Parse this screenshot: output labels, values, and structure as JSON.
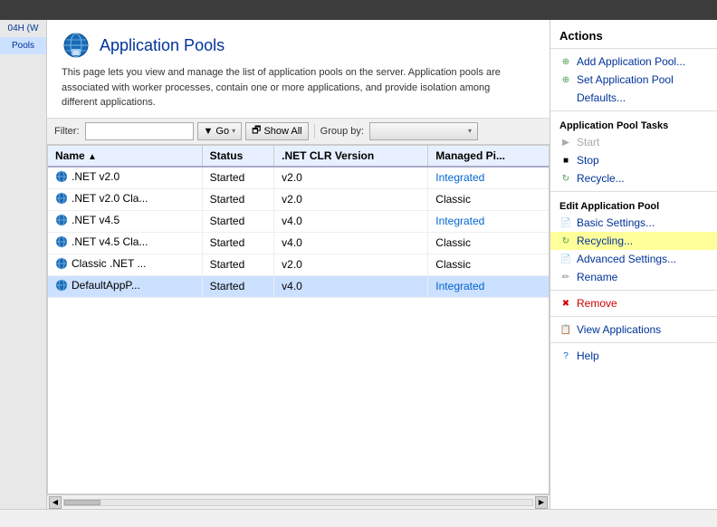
{
  "topBar": {
    "title": ""
  },
  "leftNav": {
    "items": [
      {
        "label": "04H (W",
        "active": false
      },
      {
        "label": "Pools",
        "active": true
      }
    ]
  },
  "pageHeader": {
    "title": "Application Pools",
    "description": "This page lets you view and manage the list of application pools on the server. Application pools are associated with worker processes, contain one or more applications, and provide isolation among different applications."
  },
  "toolbar": {
    "filterLabel": "Filter:",
    "filterValue": "",
    "goLabel": "Go",
    "showAllLabel": "Show All",
    "groupByLabel": "Group by:",
    "groupByValue": ""
  },
  "table": {
    "columns": [
      "Name",
      "Status",
      ".NET CLR Version",
      "Managed Pi..."
    ],
    "rows": [
      {
        "name": ".NET v2.0",
        "status": "Started",
        "clr": "v2.0",
        "managed": "Integrated",
        "selected": false
      },
      {
        "name": ".NET v2.0 Cla...",
        "status": "Started",
        "clr": "v2.0",
        "managed": "Classic",
        "selected": false
      },
      {
        "name": ".NET v4.5",
        "status": "Started",
        "clr": "v4.0",
        "managed": "Integrated",
        "selected": false
      },
      {
        "name": ".NET v4.5 Cla...",
        "status": "Started",
        "clr": "v4.0",
        "managed": "Classic",
        "selected": false
      },
      {
        "name": "Classic .NET ...",
        "status": "Started",
        "clr": "v2.0",
        "managed": "Classic",
        "selected": false
      },
      {
        "name": "DefaultAppP...",
        "status": "Started",
        "clr": "v4.0",
        "managed": "Integrated",
        "selected": true
      }
    ]
  },
  "actions": {
    "title": "Actions",
    "items": [
      {
        "section": null,
        "label": "Add Application Pool...",
        "icon": "add-icon",
        "disabled": false,
        "highlighted": false
      },
      {
        "section": null,
        "label": "Set Application Pool",
        "icon": "set-icon",
        "disabled": false,
        "highlighted": false
      },
      {
        "section": null,
        "label": "Defaults...",
        "icon": null,
        "disabled": false,
        "highlighted": false
      },
      {
        "section": "Application Pool Tasks",
        "label": "",
        "icon": null,
        "disabled": false,
        "highlighted": false
      },
      {
        "section": null,
        "label": "Start",
        "icon": "play-icon",
        "disabled": true,
        "highlighted": false
      },
      {
        "section": null,
        "label": "Stop",
        "icon": "stop-icon",
        "disabled": false,
        "highlighted": false
      },
      {
        "section": null,
        "label": "Recycle...",
        "icon": "recycle-icon",
        "disabled": false,
        "highlighted": false
      },
      {
        "section": "Edit Application Pool",
        "label": "",
        "icon": null,
        "disabled": false,
        "highlighted": false
      },
      {
        "section": null,
        "label": "Basic Settings...",
        "icon": "settings-icon",
        "disabled": false,
        "highlighted": false
      },
      {
        "section": null,
        "label": "Recycling...",
        "icon": "recycling-icon",
        "disabled": false,
        "highlighted": true
      },
      {
        "section": null,
        "label": "Advanced Settings...",
        "icon": "advanced-icon",
        "disabled": false,
        "highlighted": false
      },
      {
        "section": null,
        "label": "Rename",
        "icon": "rename-icon",
        "disabled": false,
        "highlighted": false
      },
      {
        "section": null,
        "label": "Remove",
        "icon": "remove-icon",
        "disabled": false,
        "highlighted": false
      },
      {
        "section": null,
        "label": "View Applications",
        "icon": "view-icon",
        "disabled": false,
        "highlighted": false
      },
      {
        "section": null,
        "label": "Help",
        "icon": "help-icon",
        "disabled": false,
        "highlighted": false
      }
    ]
  },
  "statusBar": {
    "text": ""
  }
}
